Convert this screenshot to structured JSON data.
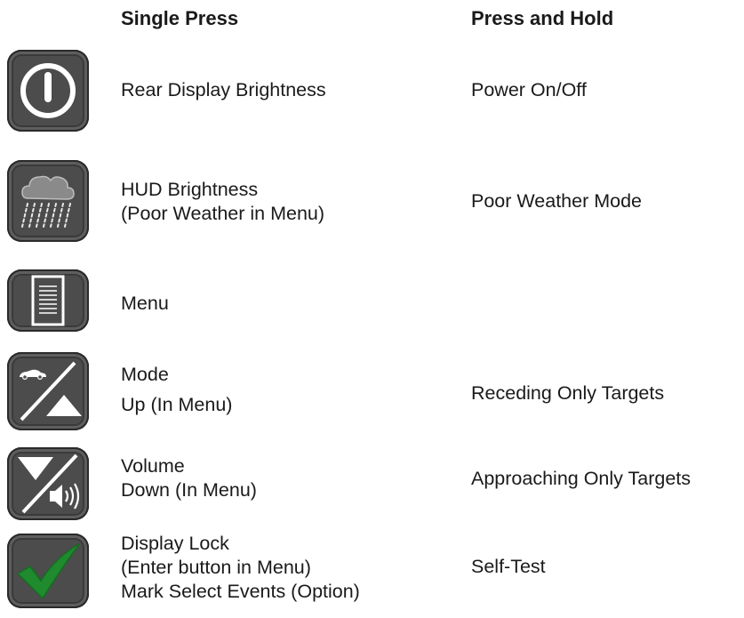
{
  "headers": {
    "single_press": "Single Press",
    "press_and_hold": "Press and Hold"
  },
  "rows": [
    {
      "icon": "power-icon",
      "single": [
        "Rear Display Brightness"
      ],
      "hold": "Power On/Off"
    },
    {
      "icon": "rain-cloud-icon",
      "single": [
        "HUD Brightness",
        "(Poor Weather in Menu)"
      ],
      "hold": "Poor Weather Mode"
    },
    {
      "icon": "menu-document-icon",
      "single": [
        "Menu"
      ],
      "hold": ""
    },
    {
      "icon": "car-up-triangle-icon",
      "single": [
        "Mode",
        "Up (In Menu)"
      ],
      "hold": "Receding Only Targets"
    },
    {
      "icon": "down-triangle-speaker-icon",
      "single": [
        "Volume",
        "Down (In Menu)"
      ],
      "hold": "Approaching Only Targets"
    },
    {
      "icon": "checkmark-icon",
      "single": [
        "Display Lock",
        "(Enter button in Menu)",
        "Mark Select Events (Option)"
      ],
      "hold": "Self-Test"
    }
  ],
  "colors": {
    "button_body": "#4c4c4c",
    "checkmark_green": "#1f8a2e",
    "icon_white": "#ffffff"
  }
}
